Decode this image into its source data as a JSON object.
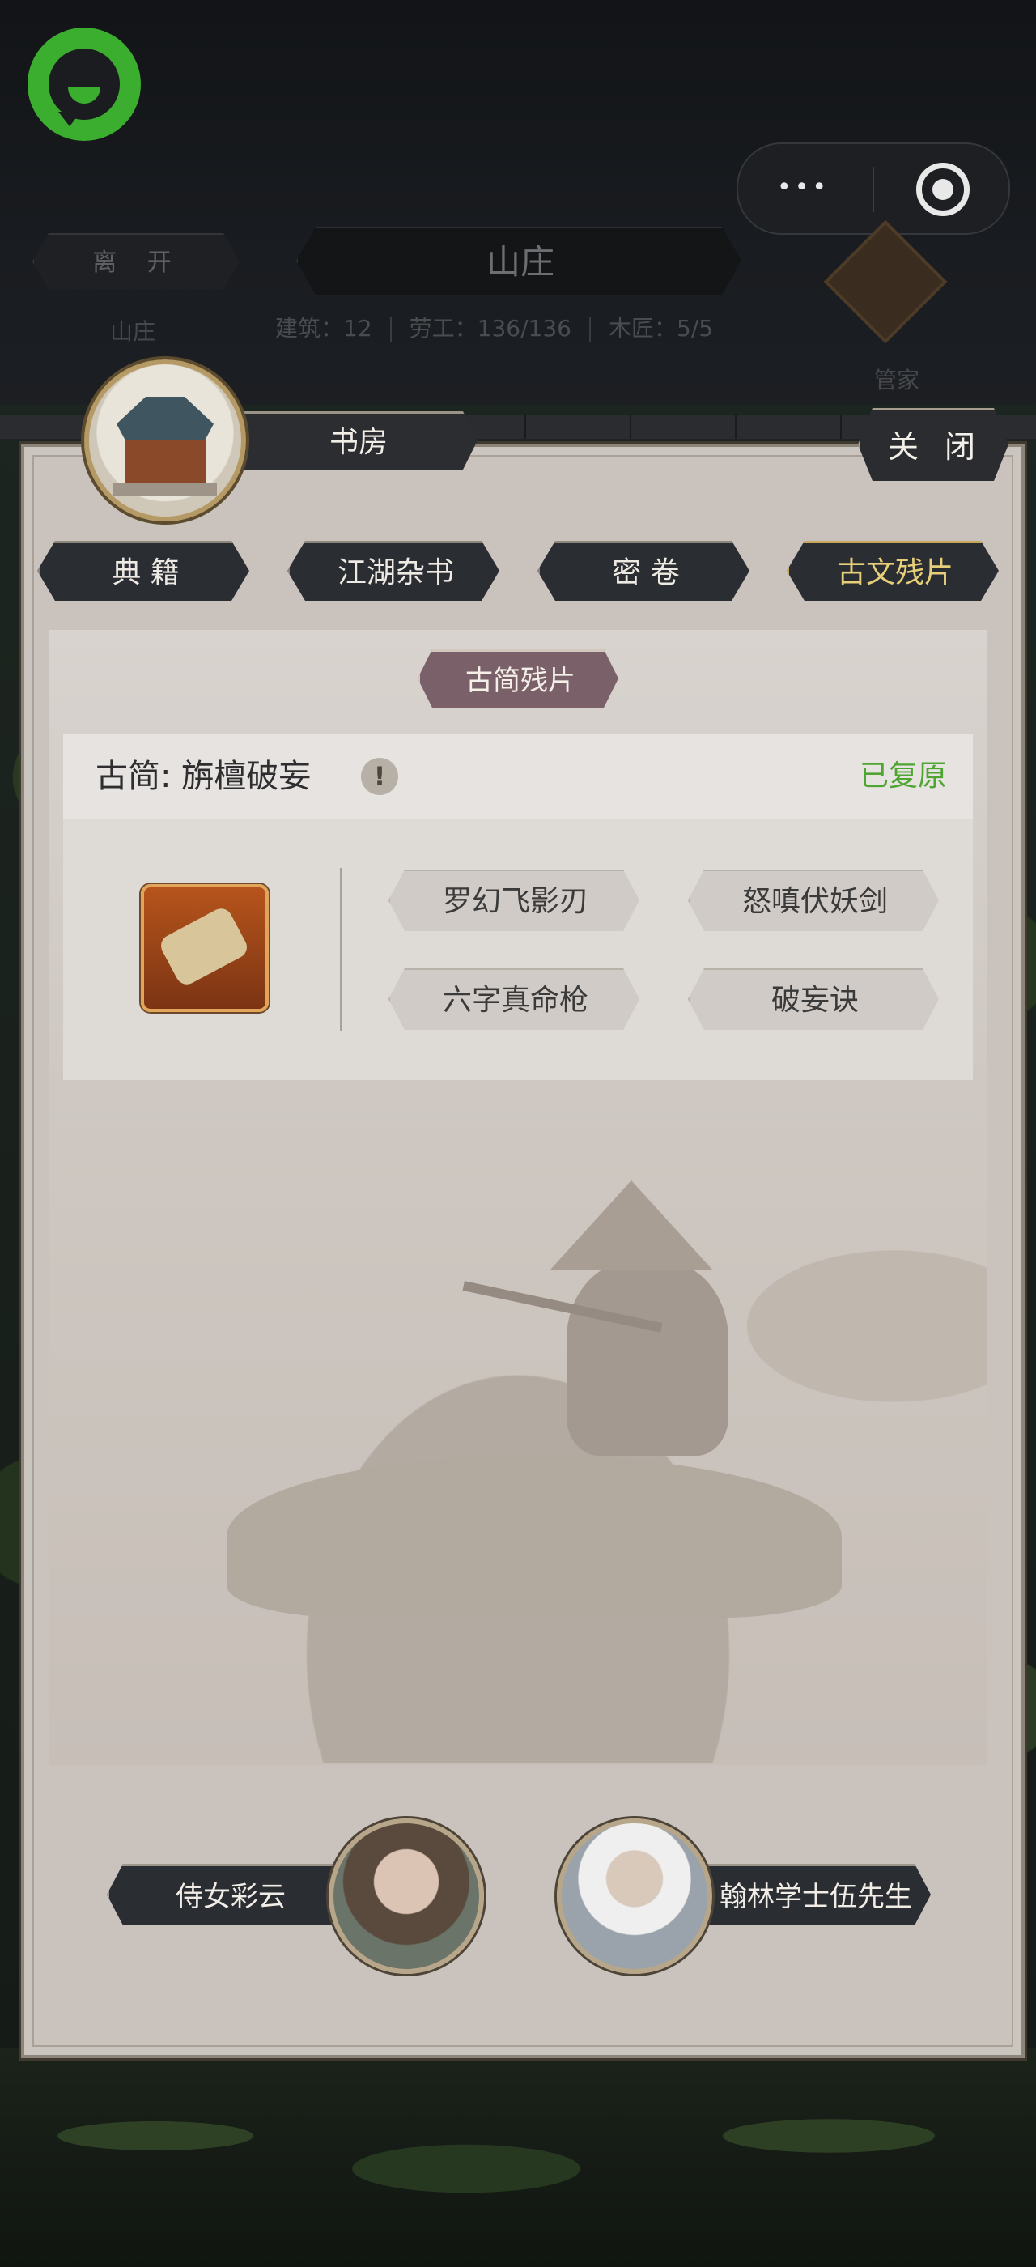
{
  "topbar": {
    "leave_label": "离 开",
    "location_title": "山庄",
    "stats": {
      "buildings": "建筑：12",
      "workers": "劳工：136/136",
      "carpenters": "木匠：5/5"
    },
    "village_label": "山庄",
    "steward_label": "管家"
  },
  "modal": {
    "room_title": "书房",
    "close_label": "关 闭",
    "tabs": [
      {
        "label": "典 籍",
        "active": false
      },
      {
        "label": "江湖杂书",
        "active": false
      },
      {
        "label": "密 卷",
        "active": false
      },
      {
        "label": "古文残片",
        "active": true
      }
    ],
    "section_title": "古简残片",
    "record": {
      "title": "古简: 旃檀破妄",
      "status": "已复原",
      "status_color": "#4ea532",
      "skills": [
        "罗幻飞影刃",
        "怒嗔伏妖剑",
        "六字真命枪",
        "破妄诀"
      ]
    },
    "npcs": {
      "left_name": "侍女彩云",
      "right_name": "翰林学士伍先生"
    }
  }
}
